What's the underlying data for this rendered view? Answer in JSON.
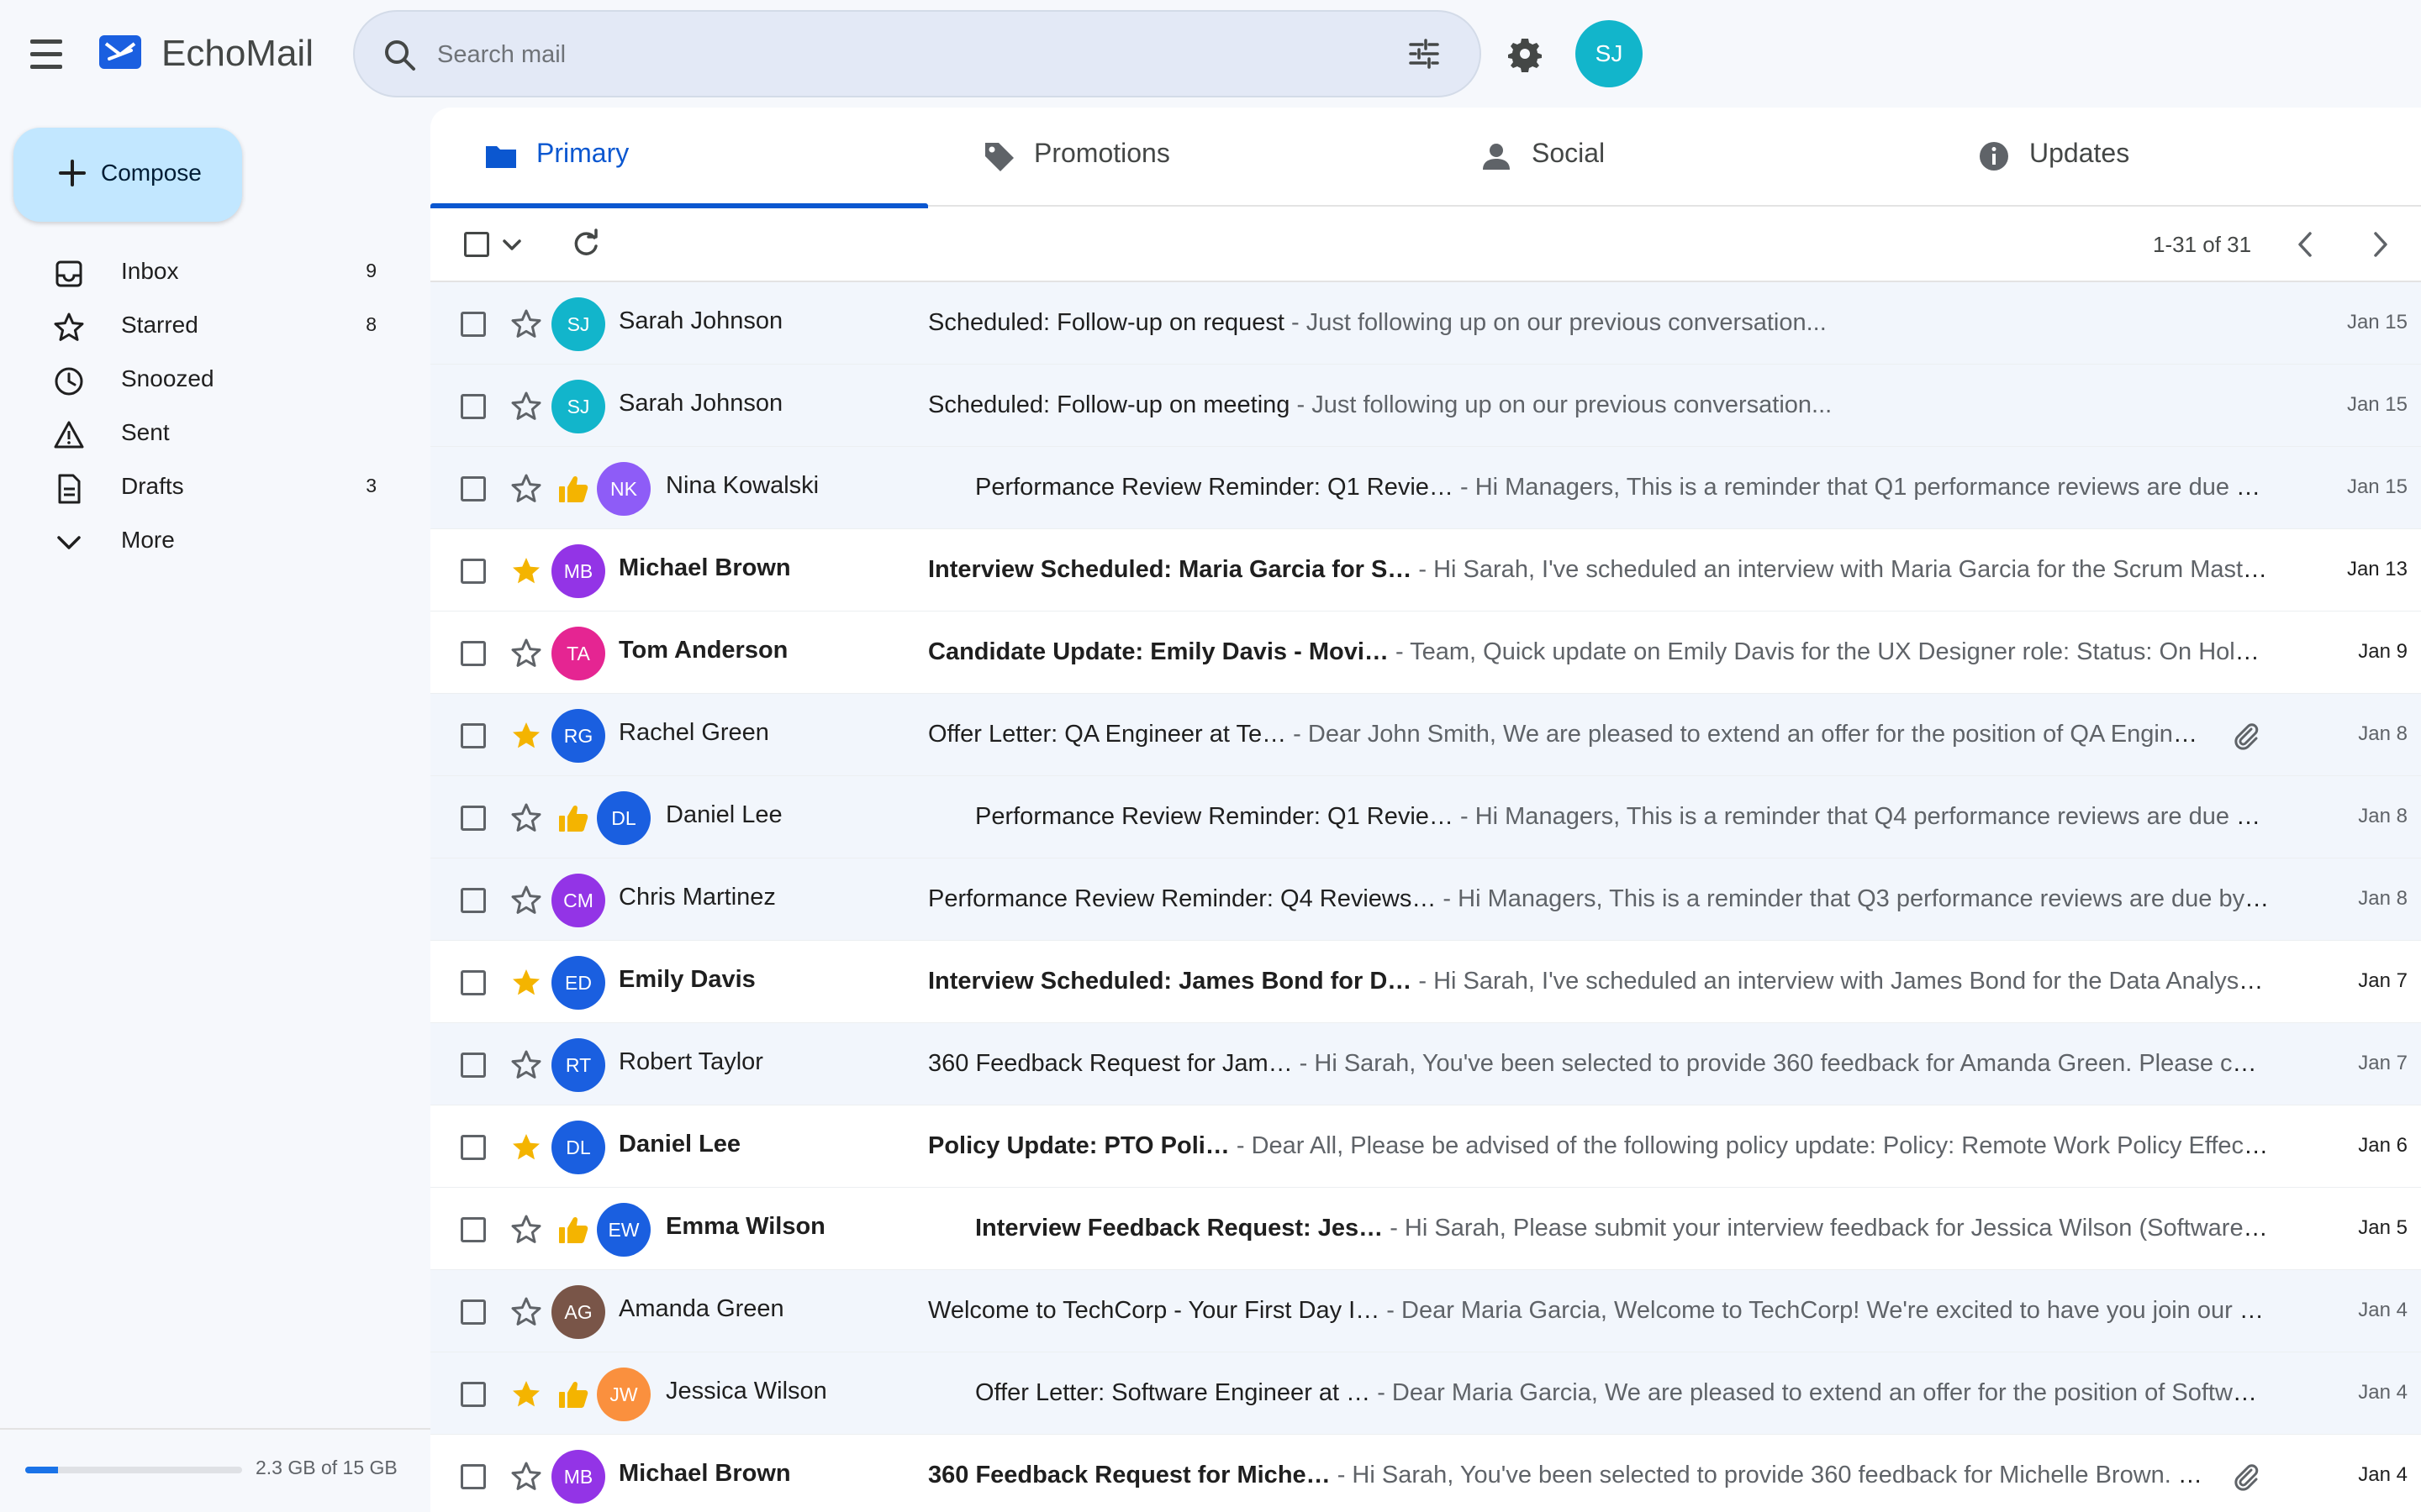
{
  "app": {
    "title": "EchoMail",
    "avatar_initials": "SJ"
  },
  "search": {
    "placeholder": "Search mail",
    "value": ""
  },
  "compose": {
    "label": "Compose"
  },
  "nav": [
    {
      "label": "Inbox",
      "count": "9",
      "icon": "inbox-icon"
    },
    {
      "label": "Starred",
      "count": "8",
      "icon": "star-icon"
    },
    {
      "label": "Snoozed",
      "count": "",
      "icon": "clock-icon"
    },
    {
      "label": "Sent",
      "count": "",
      "icon": "sent-icon"
    },
    {
      "label": "Drafts",
      "count": "3",
      "icon": "draft-icon"
    },
    {
      "label": "More",
      "count": "",
      "icon": "chevron-down-icon"
    }
  ],
  "storage": {
    "text": "2.3 GB of 15 GB",
    "fraction": 0.153
  },
  "tabs": [
    {
      "label": "Primary",
      "icon": "folder-icon",
      "active": true
    },
    {
      "label": "Promotions",
      "icon": "tag-icon",
      "active": false
    },
    {
      "label": "Social",
      "icon": "person-icon",
      "active": false
    },
    {
      "label": "Updates",
      "icon": "info-icon",
      "active": false
    }
  ],
  "toolbar": {
    "range": "1-31 of 31"
  },
  "colors": {
    "accent": "#0b57d0",
    "star_gold": "#f4b400",
    "compose_bg": "#c2e7ff",
    "avatar_cyan": "#12b5cb",
    "avatar_purple": "#9334e6",
    "avatar_violet": "#8e5cf7",
    "avatar_pink": "#e52592",
    "avatar_blue": "#1a5fe0",
    "avatar_brown": "#795548",
    "avatar_orange": "#fa903e"
  },
  "emails": [
    {
      "sender": "Sarah Johnson",
      "initials": "SJ",
      "avatar_color": "#12b5cb",
      "starred": false,
      "important": false,
      "unread": false,
      "subject": "Scheduled: Follow-up on request",
      "snippet": " - Just following up on our previous conversation...",
      "attachment": false,
      "date": "Jan 15"
    },
    {
      "sender": "Sarah Johnson",
      "initials": "SJ",
      "avatar_color": "#12b5cb",
      "starred": false,
      "important": false,
      "unread": false,
      "subject": "Scheduled: Follow-up on meeting",
      "snippet": " - Just following up on our previous conversation...",
      "attachment": false,
      "date": "Jan 15"
    },
    {
      "sender": "Nina Kowalski",
      "initials": "NK",
      "avatar_color": "#8e5cf7",
      "starred": false,
      "important": true,
      "unread": false,
      "subject": "Performance Review Reminder: Q1 Revie…",
      "snippet": " - Hi Managers, This is a reminder that Q1 performance reviews are due by…",
      "attachment": false,
      "date": "Jan 15"
    },
    {
      "sender": "Michael Brown",
      "initials": "MB",
      "avatar_color": "#9334e6",
      "starred": true,
      "important": false,
      "unread": true,
      "subject": "Interview Scheduled: Maria Garcia for S…",
      "snippet": " - Hi Sarah, I've scheduled an interview with Maria Garcia for the Scrum Master …",
      "attachment": false,
      "date": "Jan 13"
    },
    {
      "sender": "Tom Anderson",
      "initials": "TA",
      "avatar_color": "#e52592",
      "starred": false,
      "important": false,
      "unread": true,
      "subject": "Candidate Update: Emily Davis - Movi…",
      "snippet": " - Team, Quick update on Emily Davis for the UX Designer role: Status: On Hold N…",
      "attachment": false,
      "date": "Jan 9"
    },
    {
      "sender": "Rachel Green",
      "initials": "RG",
      "avatar_color": "#1a5fe0",
      "starred": true,
      "important": false,
      "unread": false,
      "subject": "Offer Letter: QA Engineer at Te…",
      "snippet": " - Dear John Smith, We are pleased to extend an offer for the position of QA Engineer a…",
      "attachment": true,
      "date": "Jan 8"
    },
    {
      "sender": "Daniel Lee",
      "initials": "DL",
      "avatar_color": "#1a5fe0",
      "starred": false,
      "important": true,
      "unread": false,
      "subject": "Performance Review Reminder: Q1 Revie…",
      "snippet": " - Hi Managers, This is a reminder that Q4 performance reviews are due by…",
      "attachment": false,
      "date": "Jan 8"
    },
    {
      "sender": "Chris Martinez",
      "initials": "CM",
      "avatar_color": "#9334e6",
      "starred": false,
      "important": false,
      "unread": false,
      "subject": "Performance Review Reminder: Q4 Reviews…",
      "snippet": " - Hi Managers, This is a reminder that Q3 performance reviews are due by J…",
      "attachment": false,
      "date": "Jan 8"
    },
    {
      "sender": "Emily Davis",
      "initials": "ED",
      "avatar_color": "#1a5fe0",
      "starred": true,
      "important": false,
      "unread": true,
      "subject": "Interview Scheduled: James Bond for D…",
      "snippet": " - Hi Sarah, I've scheduled an interview with James Bond for the Data Analyst po…",
      "attachment": false,
      "date": "Jan 7"
    },
    {
      "sender": "Robert Taylor",
      "initials": "RT",
      "avatar_color": "#1a5fe0",
      "starred": false,
      "important": false,
      "unread": false,
      "subject": "360 Feedback Request for Jam…",
      "snippet": " - Hi Sarah, You've been selected to provide 360 feedback for Amanda Green. Please com…",
      "attachment": false,
      "date": "Jan 7"
    },
    {
      "sender": "Daniel Lee",
      "initials": "DL",
      "avatar_color": "#1a5fe0",
      "starred": true,
      "important": false,
      "unread": true,
      "subject": "Policy Update: PTO Poli…",
      "snippet": " - Dear All, Please be advised of the following policy update: Policy: Remote Work Policy Effectiv…",
      "attachment": false,
      "date": "Jan 6"
    },
    {
      "sender": "Emma Wilson",
      "initials": "EW",
      "avatar_color": "#1a5fe0",
      "starred": false,
      "important": true,
      "unread": true,
      "subject": "Interview Feedback Request: Jes…",
      "snippet": " - Hi Sarah, Please submit your interview feedback for Jessica Wilson (Software E…",
      "attachment": false,
      "date": "Jan 5"
    },
    {
      "sender": "Amanda Green",
      "initials": "AG",
      "avatar_color": "#795548",
      "starred": false,
      "important": false,
      "unread": false,
      "subject": "Welcome to TechCorp - Your First Day I…",
      "snippet": " - Dear Maria Garcia, Welcome to TechCorp! We're excited to have you join our tea…",
      "attachment": false,
      "date": "Jan 4"
    },
    {
      "sender": "Jessica Wilson",
      "initials": "JW",
      "avatar_color": "#fa903e",
      "starred": true,
      "important": true,
      "unread": false,
      "subject": "Offer Letter: Software Engineer at …",
      "snippet": " - Dear Maria Garcia, We are pleased to extend an offer for the position of Software …",
      "attachment": false,
      "date": "Jan 4"
    },
    {
      "sender": "Michael Brown",
      "initials": "MB",
      "avatar_color": "#9334e6",
      "starred": false,
      "important": false,
      "unread": true,
      "subject": "360 Feedback Request for Miche…",
      "snippet": " - Hi Sarah, You've been selected to provide 360 feedback for Michelle Brown. Plea…",
      "attachment": true,
      "date": "Jan 4"
    }
  ]
}
